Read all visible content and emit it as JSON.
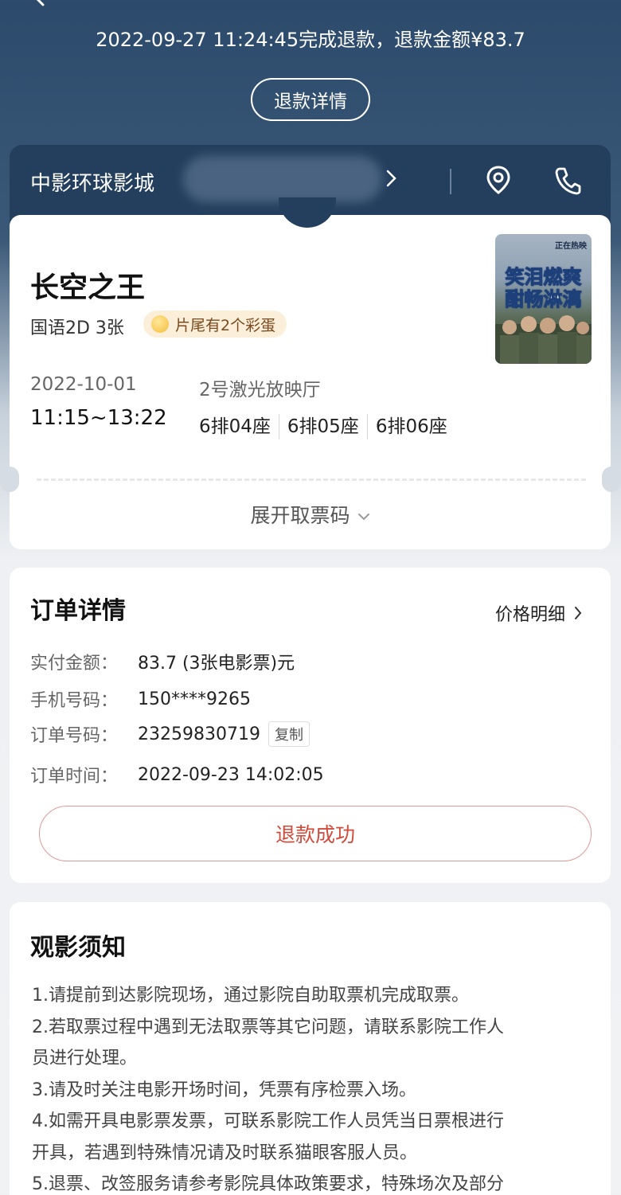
{
  "header": {
    "refund_info": "2022-09-27 11:24:45完成退款，退款金额¥83.7",
    "refund_detail_button": "退款详情"
  },
  "cinema": {
    "name": "中影环球影城"
  },
  "ticket": {
    "movie_title": "长空之王",
    "format": "国语2D 3张",
    "egg_badge": "片尾有2个彩蛋",
    "poster": {
      "tag": "正在热映",
      "slogan_line1": "笑泪燃爽",
      "slogan_line2": "酣畅淋漓"
    },
    "date": "2022-10-01",
    "time": "11:15~13:22",
    "hall": "2号激光放映厅",
    "seats": [
      "6排04座",
      "6排05座",
      "6排06座"
    ],
    "expand_code": "展开取票码"
  },
  "order": {
    "title": "订单详情",
    "price_detail": "价格明细",
    "rows": [
      {
        "label": "实付金额：",
        "value": "83.7 (3张电影票)元"
      },
      {
        "label": "手机号码：",
        "value": "150****9265"
      },
      {
        "label": "订单号码：",
        "value": "23259830719"
      },
      {
        "label": "订单时间：",
        "value": "2022-09-23 14:02:05"
      }
    ],
    "copy_button": "复制",
    "status_button": "退款成功"
  },
  "notice": {
    "title": "观影须知",
    "lines": [
      "1.请提前到达影院现场，通过影院自助取票机完成取票。",
      "2.若取票过程中遇到无法取票等其它问题，请联系影院工作人",
      "员进行处理。",
      "3.请及时关注电影开场时间，凭票有序检票入场。",
      "4.如需开具电影票发票，可联系影院工作人员凭当日票根进行",
      "开具，若遇到特殊情况请及时联系猫眼客服人员。",
      "5.退票、改签服务请参考影院具体政策要求，特殊场次及部分"
    ]
  },
  "colors": {
    "header_bg": "#2c4a6b",
    "cinema_bar": "#243f5d",
    "refund_red": "#d24a3a",
    "egg_badge_bg": "#fcefd9"
  }
}
